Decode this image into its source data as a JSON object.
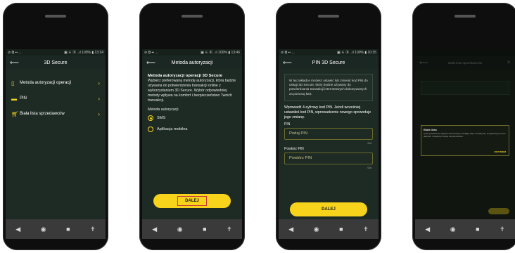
{
  "phone1": {
    "status_left": "⊘ ⧉ ▪▪ ...",
    "status_right": "▣ ⚟ ⦿ ..ıl 100% ▮ 13:34",
    "title": "3D Secure",
    "items": [
      {
        "icon": "phone-icon",
        "label": "Metoda autoryzacji operacji"
      },
      {
        "icon": "pin-icon",
        "label": "PIN"
      },
      {
        "icon": "cart-icon",
        "label": "Biała lista sprzedawców"
      }
    ]
  },
  "phone2": {
    "status_left": "⊘ ⧉ ▪▪ ...",
    "status_right": "▣ ⚟ ⦿ ..ıl 100% ▮ 13:46",
    "title": "Metoda autoryzacji",
    "heading": "Metoda autoryzacji operacji 3D Secure",
    "desc": "Wybierz preferowaną metodę autoryzacji, która będzie używana do potwierdzenia transakcji online z wykorzystaniem 3D Secure. Wybór odpowiedniej metody wpływa na komfort i bezpieczeństwo Twoich transakcji.",
    "method_label": "Metoda autoryzacji",
    "options": [
      {
        "label": "SMS",
        "selected": true
      },
      {
        "label": "Aplikacja mobilna",
        "selected": false
      }
    ],
    "button": "DALEJ"
  },
  "phone3": {
    "status_left": "⊘ ⧉ ▪▪ ...",
    "status_right": "▣ ⚟ ⦿ ..ıl 100% ▮ 10:35",
    "title": "PIN 3D Secure",
    "info": "W tej zakładce możesz ustawić lub zmienić kod PIN do usługi 3D Secure, który będzie używany do potwierdzania transakcji internetowych dokonywanych za pomocą kart.",
    "instruction": "Wprowadź 4-cyfrowy kod PIN. Jeżeli wcześniej ustawiłeś kod PIN, wprowadzenie nowego spowoduje jego zmianę.",
    "pin_label": "PIN",
    "pin_placeholder": "Podaj PIN",
    "pin_counter": "0/4",
    "repeat_label": "Powtórz PIN",
    "repeat_placeholder": "Powtórz PIN",
    "repeat_counter": "0/4",
    "button": "DALEJ"
  },
  "phone4": {
    "title": "Biała lista sprzedawców",
    "popup_title": "Biała lista",
    "popup_text": "Lista sprzedawców objętych internetowymi. Dodając sklep na białą listę, przyspieszysz proces płatności i zwiększysz swoje bezpieczeństwo.",
    "popup_button": "ROZUMIEM"
  },
  "nav": {
    "back": "◀",
    "home": "◉",
    "recent": "■",
    "access": "✝"
  }
}
